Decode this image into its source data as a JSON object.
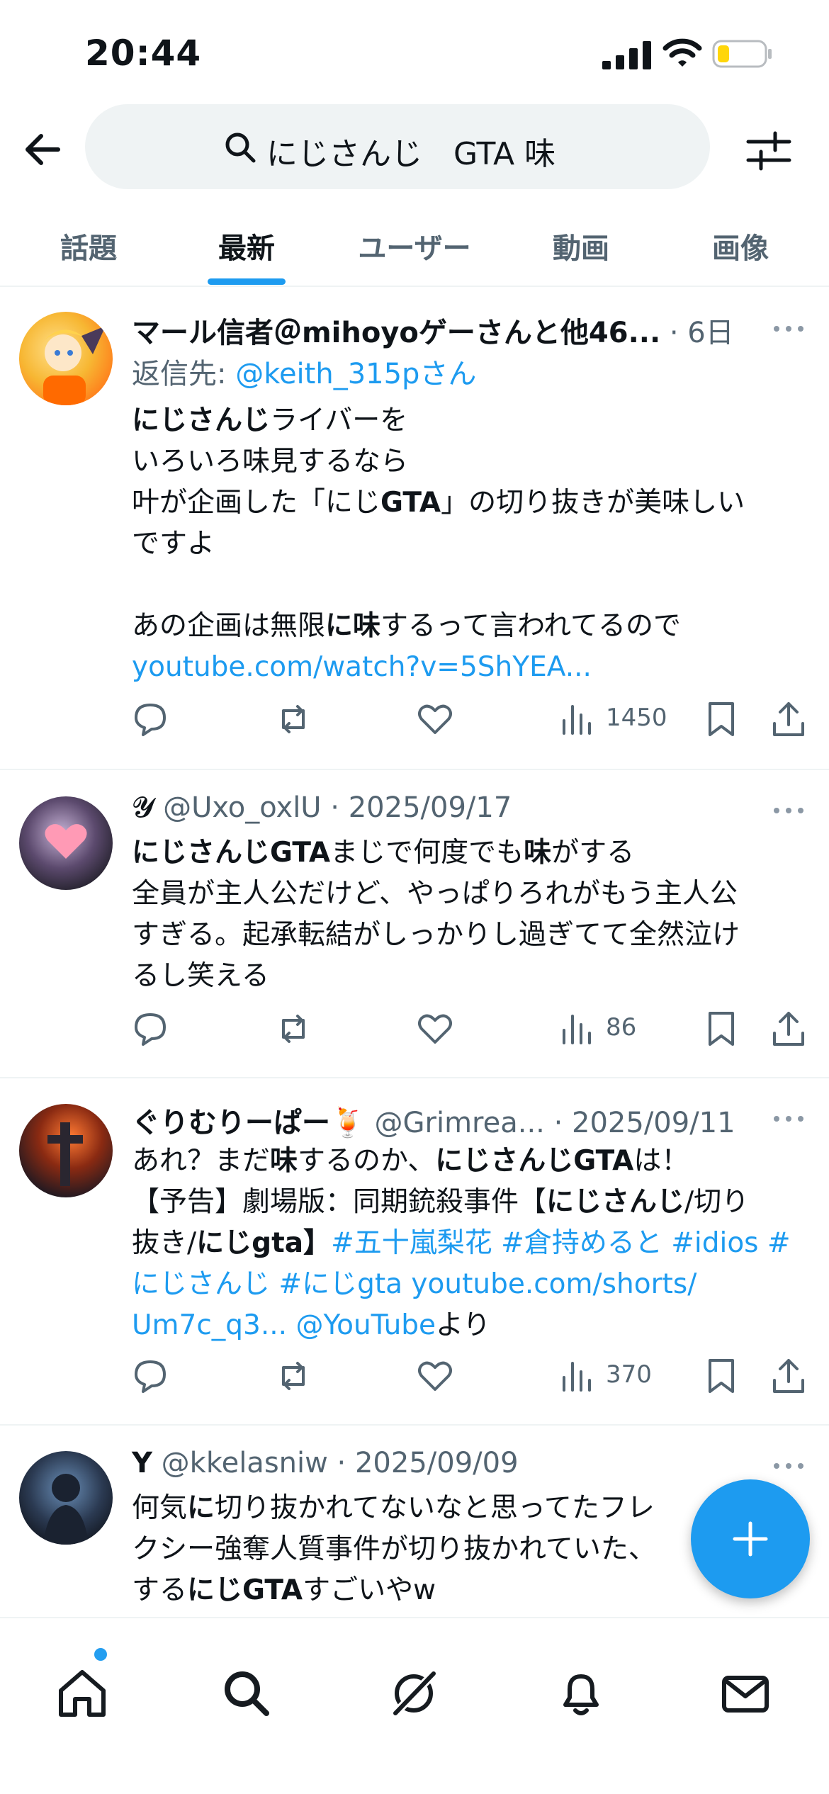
{
  "status_bar": {
    "time": "20:44"
  },
  "search": {
    "query": "にじさんじ　GTA 味"
  },
  "tabs": [
    "話題",
    "最新",
    "ユーザー",
    "動画",
    "画像"
  ],
  "posts": [
    {
      "name": "マール信者＠mihoyoゲーさんと他46...",
      "meta": " · 6日",
      "reply_prefix": "返信先: ",
      "reply_handle": "@keith_315pさん",
      "lines": [
        [
          "<b>にじさんじ</b>ライバーを"
        ],
        [
          "いろいろ味見するなら"
        ],
        [
          "叶が企画した「にじ<b>GTA</b>」の切り抜きが美味しい"
        ],
        [
          "ですよ"
        ],
        [
          ""
        ],
        [
          "あの企画は無限<b>に</b><b>味</b>するって言われてるので"
        ]
      ],
      "link": "youtube.com/watch?v=5ShYEA...",
      "views": "1450"
    },
    {
      "name": "𝓨",
      "meta": " @Uxo_oxlU · 2025/09/17",
      "text_1": "にじさんじGTA",
      "text_2": "まじで何度でも",
      "text_3": "味",
      "text_4": "がする",
      "text_5": "全員が主人公だけど、やっぱりろれがもう主人公",
      "text_6": "すぎる。起承転結がしっかりし過ぎてて全然泣け",
      "text_7": "るし笑える",
      "views": "86"
    },
    {
      "name": "ぐりむりーぱー🍹",
      "meta": " @Grimrea... · 2025/09/11",
      "views": "370",
      "text_1": "あれ？まだ",
      "text_2": "味",
      "text_3": "するのか、",
      "text_4": "にじさんじGTA",
      "text_5": "は！",
      "text_6": "【予告】劇場版：同期銃殺事件【",
      "text_7": "にじさんじ",
      "text_8": "/切り",
      "text_9": "抜き/",
      "text_10": "にじ",
      "text_11": "gta",
      "text_12": "】",
      "tags_1": "#五十嵐梨花 #倉持めると #idios #",
      "tags_2": "にじさんじ #にじgta youtube.com/shorts/",
      "tags_3": "Um7c_q3... @YouTube",
      "text_13": "より"
    },
    {
      "name": "Y",
      "meta": " @kkelasniw · 2025/09/09",
      "text_1": "何気",
      "text_2": "に",
      "text_3": "切り抜かれてないなと思ってたフレ",
      "text_4": "クシー強奪人質事件が切り抜かれていた、",
      "text_5": "する",
      "text_6": "にじGTA",
      "text_7": "すごいやw"
    }
  ],
  "colors": {
    "accent": "#1d9bf0",
    "text": "#0f1419",
    "muted": "#536471"
  }
}
